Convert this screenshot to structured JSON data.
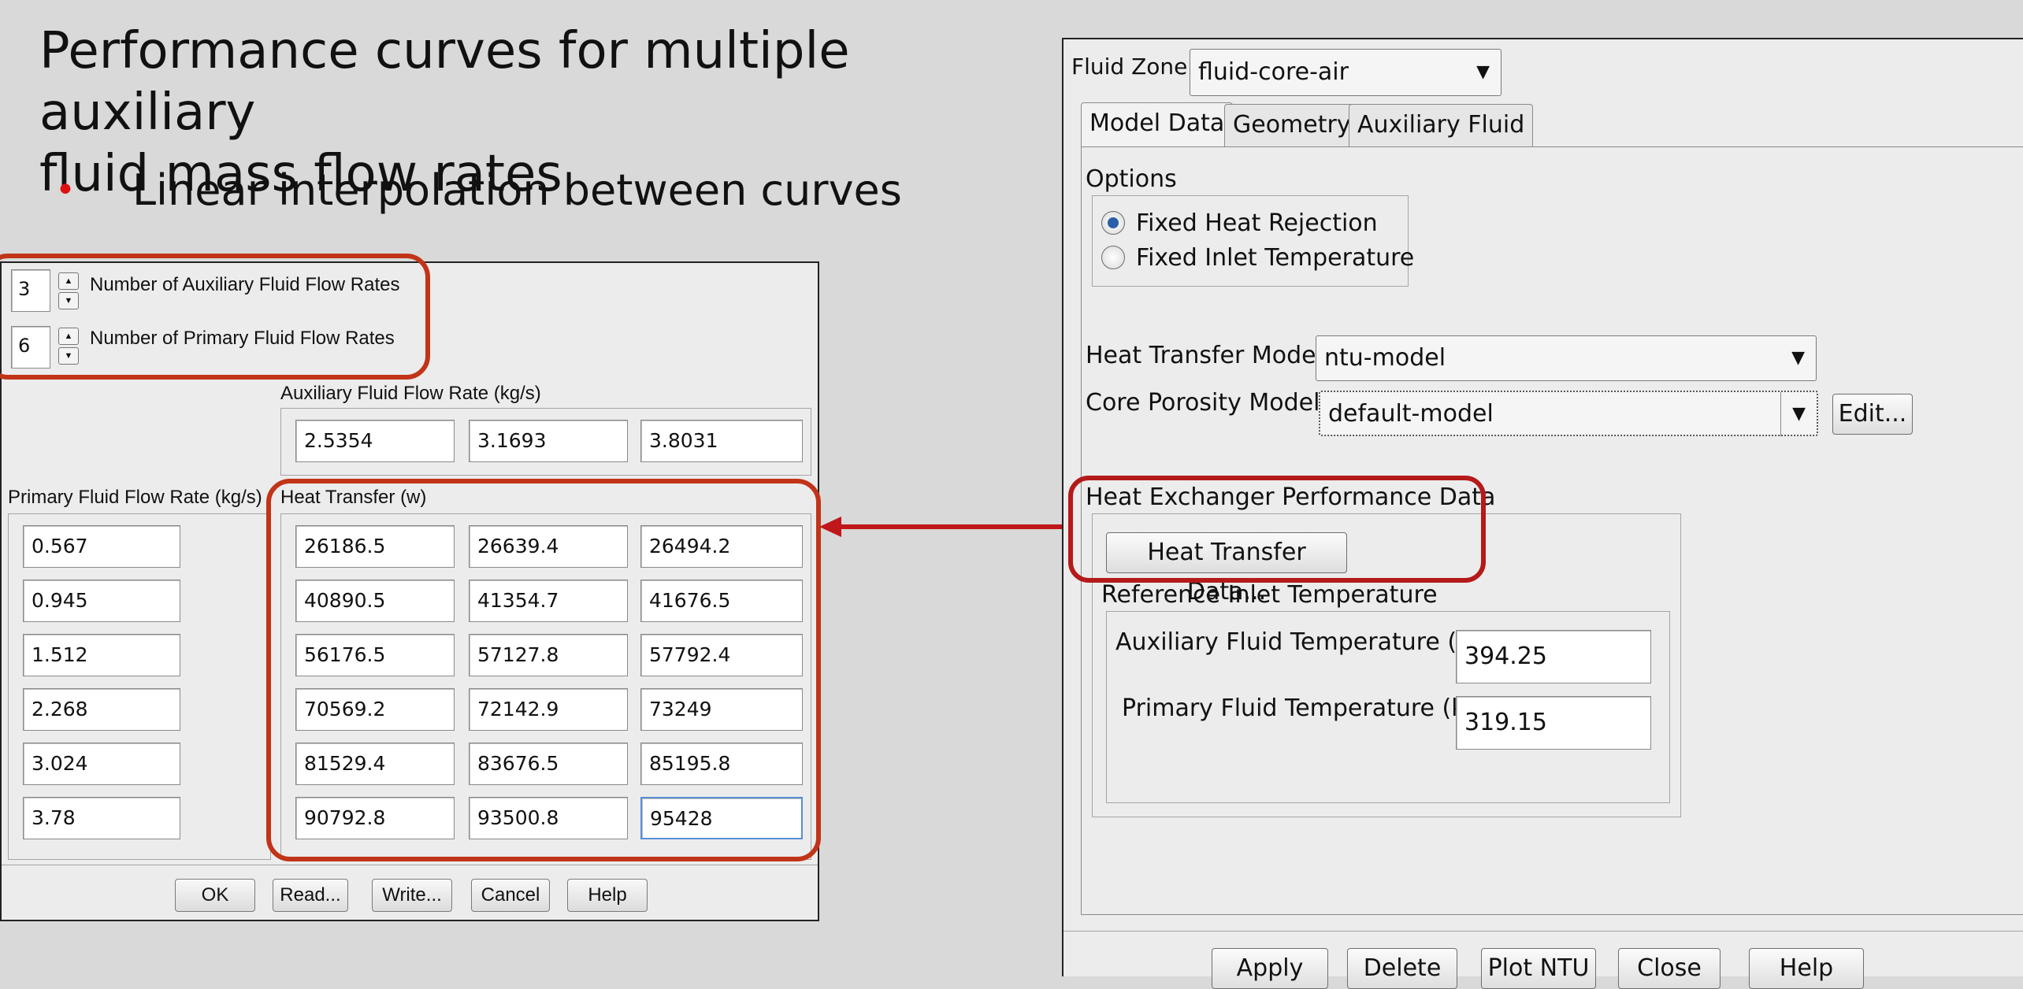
{
  "slide": {
    "title_line1": "Performance curves for multiple auxiliary",
    "title_line2": "fluid mass flow rates",
    "bullet": "Linear interpolation between curves"
  },
  "left_dialog": {
    "aux_count": "3",
    "aux_count_label": "Number of Auxiliary Fluid Flow Rates",
    "primary_count": "6",
    "primary_count_label": "Number of Primary Fluid Flow Rates",
    "aux_rate_label": "Auxiliary Fluid Flow Rate (kg/s)",
    "aux_rates": [
      "2.5354",
      "3.1693",
      "3.8031"
    ],
    "primary_rate_label": "Primary Fluid Flow Rate (kg/s)",
    "heat_transfer_label": "Heat Transfer (w)",
    "primary_rates": [
      "0.567",
      "0.945",
      "1.512",
      "2.268",
      "3.024",
      "3.78"
    ],
    "heat_rows": [
      [
        "26186.5",
        "26639.4",
        "26494.2"
      ],
      [
        "40890.5",
        "41354.7",
        "41676.5"
      ],
      [
        "56176.5",
        "57127.8",
        "57792.4"
      ],
      [
        "70569.2",
        "72142.9",
        "73249"
      ],
      [
        "81529.4",
        "83676.5",
        "85195.8"
      ],
      [
        "90792.8",
        "93500.8",
        "95428"
      ]
    ],
    "buttons": [
      "OK",
      "Read...",
      "Write...",
      "Cancel",
      "Help"
    ]
  },
  "right_dialog": {
    "fluid_zone_label": "Fluid Zone",
    "fluid_zone_value": "fluid-core-air",
    "tabs": [
      "Model Data",
      "Geometry",
      "Auxiliary Fluid"
    ],
    "options_label": "Options",
    "option1": "Fixed Heat Rejection",
    "option2": "Fixed Inlet Temperature",
    "heat_transfer_model_label": "Heat Transfer Model",
    "heat_transfer_model_value": "ntu-model",
    "core_porosity_label": "Core Porosity Model",
    "core_porosity_value": "default-model",
    "edit_button": "Edit...",
    "performance_label": "Heat Exchanger Performance Data",
    "heat_transfer_data_button": "Heat Transfer Data...",
    "ref_inlet_label": "Reference Inlet Temperature",
    "aux_temp_label": "Auxiliary Fluid Temperature (k)",
    "aux_temp_value": "394.25",
    "primary_temp_label": "Primary Fluid Temperature (k)",
    "primary_temp_value": "319.15",
    "buttons": [
      "Apply",
      "Delete",
      "Plot NTU",
      "Close",
      "Help"
    ]
  },
  "colors": {
    "highlight_red": "#c13418",
    "arrow_red": "#c0171a"
  }
}
